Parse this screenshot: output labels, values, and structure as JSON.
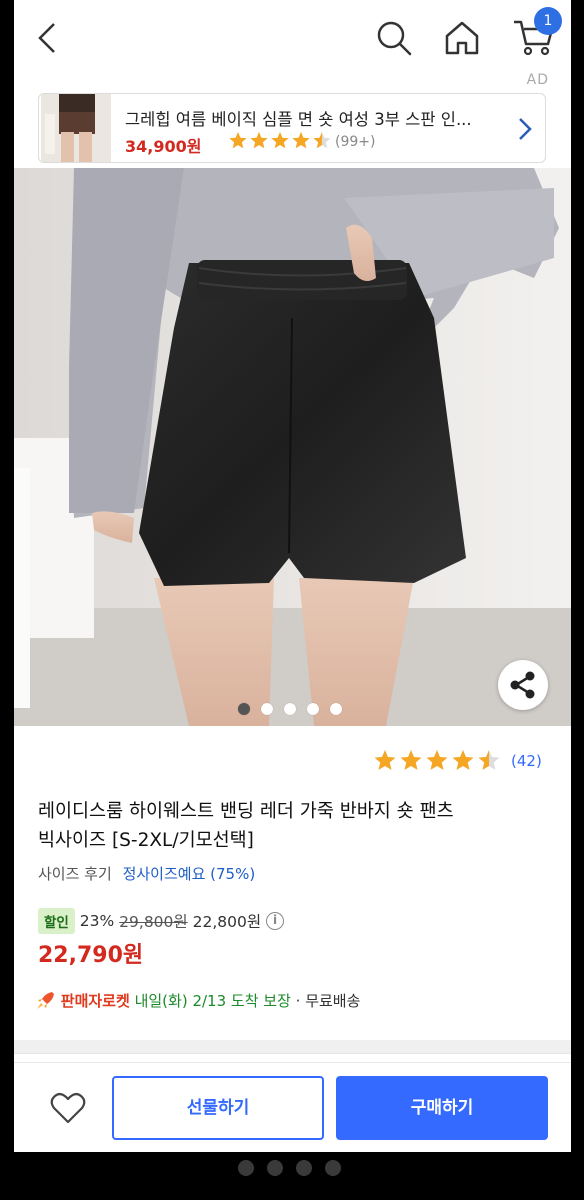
{
  "header": {
    "cart_count": "1",
    "ad_label": "AD"
  },
  "ad": {
    "title": "그레힙 여름 베이직 심플 면 숏 여성 3부 스판 인...",
    "price": "34,900원",
    "rating": 4.5,
    "reviews": "(99+)"
  },
  "gallery": {
    "image_count": 5,
    "active_index": 0
  },
  "product": {
    "rating": 4.5,
    "review_count": "(42)",
    "title_line1": "레이디스룸 하이웨스트 밴딩 레더 가죽 반바지 숏 팬츠",
    "title_line2": "빅사이즈 [S-2XL/기모선택]",
    "size_label": "사이즈 후기",
    "size_value": "정사이즈예요 (75%)",
    "sale_badge": "할인",
    "discount": "23%",
    "original_price": "29,800원",
    "sale_price": "22,800원",
    "final_price": "22,790원",
    "rocket_label": "판매자로켓",
    "delivery_date": "내일(화) 2/13 도착 보장",
    "shipping": "· 무료배송"
  },
  "actions": {
    "gift_label": "선물하기",
    "buy_label": "구매하기"
  },
  "colors": {
    "accent": "#346aff",
    "price_red": "#d3291f",
    "star": "#f5a623"
  }
}
